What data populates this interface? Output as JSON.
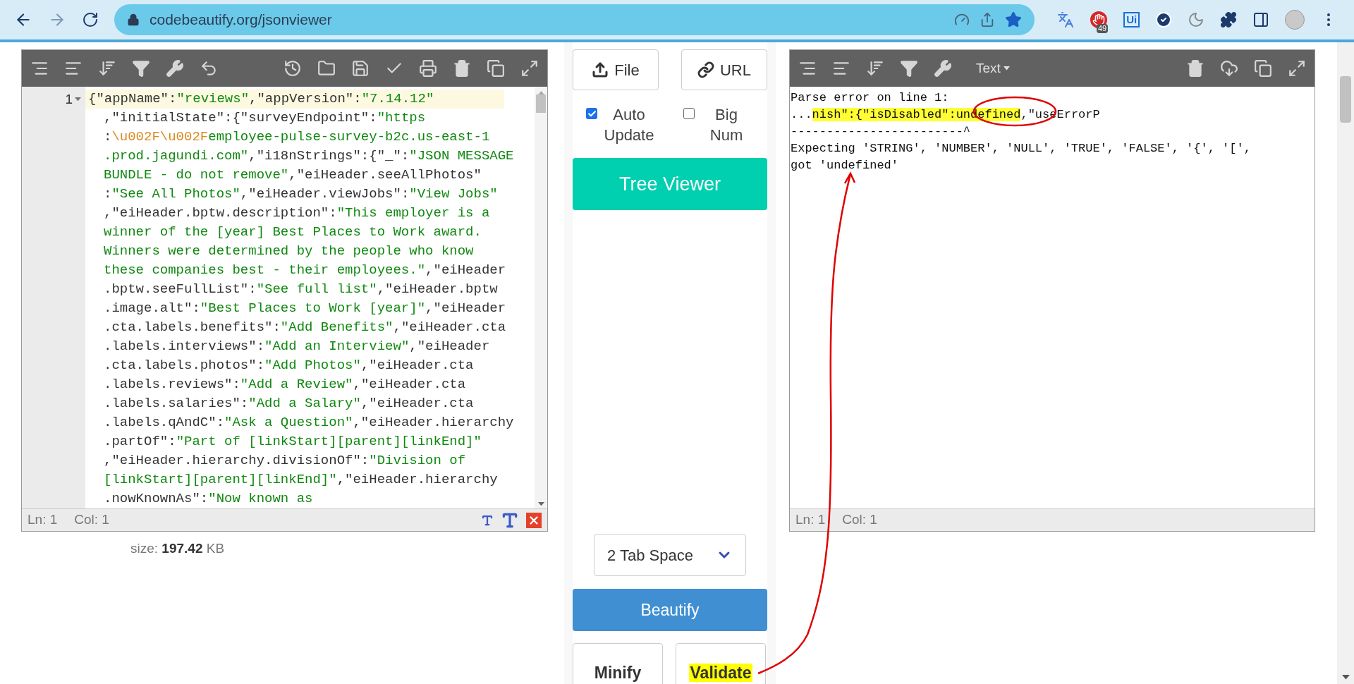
{
  "browser": {
    "url": "codebeautify.org/jsonviewer",
    "back_disabled": false,
    "forward_disabled": true,
    "bookmarked": true,
    "extensions": [
      {
        "kind": "translate"
      },
      {
        "kind": "blocker",
        "badge": "49"
      },
      {
        "kind": "ui",
        "label": "Ui"
      },
      {
        "kind": "check"
      },
      {
        "kind": "moon"
      },
      {
        "kind": "puzzle"
      },
      {
        "kind": "sidebar"
      },
      {
        "kind": "avatar"
      },
      {
        "kind": "menu"
      }
    ]
  },
  "input_editor": {
    "toolbar": [
      {
        "kind": "format"
      },
      {
        "kind": "compact"
      },
      {
        "kind": "sort"
      },
      {
        "kind": "filter"
      },
      {
        "kind": "repair"
      },
      {
        "kind": "undo"
      },
      {
        "kind": "spacer"
      },
      {
        "kind": "history"
      },
      {
        "kind": "open"
      },
      {
        "kind": "save"
      },
      {
        "kind": "check"
      },
      {
        "kind": "print"
      },
      {
        "kind": "delete"
      },
      {
        "kind": "copy"
      },
      {
        "kind": "fullscreen"
      }
    ],
    "line_number": "1",
    "lines": [
      [
        {
          "kind": "plain",
          "text": "{\"appName\":"
        },
        {
          "kind": "string",
          "text": "\"reviews\""
        },
        {
          "kind": "plain",
          "text": ",\"appVersion\":"
        },
        {
          "kind": "string",
          "text": "\"7.14.12\""
        }
      ],
      [
        {
          "kind": "plain",
          "text": ",\"initialState\":{\"surveyEndpoint\":"
        },
        {
          "kind": "string",
          "text": "\"https"
        }
      ],
      [
        {
          "kind": "plain",
          "text": ":"
        },
        {
          "kind": "escape",
          "text": "\\u002F\\u002F"
        },
        {
          "kind": "string",
          "text": "employee-pulse-survey-b2c.us-east-1"
        }
      ],
      [
        {
          "kind": "string",
          "text": ".prod.jagundi.com\""
        },
        {
          "kind": "plain",
          "text": ",\"i18nStrings\":{\"_\":"
        },
        {
          "kind": "string",
          "text": "\"JSON MESSAGE"
        }
      ],
      [
        {
          "kind": "string",
          "text": "BUNDLE - do not remove\""
        },
        {
          "kind": "plain",
          "text": ",\"eiHeader.seeAllPhotos\""
        }
      ],
      [
        {
          "kind": "plain",
          "text": ":"
        },
        {
          "kind": "string",
          "text": "\"See All Photos\""
        },
        {
          "kind": "plain",
          "text": ",\"eiHeader.viewJobs\":"
        },
        {
          "kind": "string",
          "text": "\"View Jobs\""
        }
      ],
      [
        {
          "kind": "plain",
          "text": ",\"eiHeader.bptw.description\":"
        },
        {
          "kind": "string",
          "text": "\"This employer is a"
        }
      ],
      [
        {
          "kind": "string",
          "text": "winner of the [year] Best Places to Work award."
        }
      ],
      [
        {
          "kind": "string",
          "text": "Winners were determined by the people who know"
        }
      ],
      [
        {
          "kind": "string",
          "text": "these companies best - their employees.\""
        },
        {
          "kind": "plain",
          "text": ",\"eiHeader"
        }
      ],
      [
        {
          "kind": "plain",
          "text": ".bptw.seeFullList\":"
        },
        {
          "kind": "string",
          "text": "\"See full list\""
        },
        {
          "kind": "plain",
          "text": ",\"eiHeader.bptw"
        }
      ],
      [
        {
          "kind": "plain",
          "text": ".image.alt\":"
        },
        {
          "kind": "string",
          "text": "\"Best Places to Work [year]\""
        },
        {
          "kind": "plain",
          "text": ",\"eiHeader"
        }
      ],
      [
        {
          "kind": "plain",
          "text": ".cta.labels.benefits\":"
        },
        {
          "kind": "string",
          "text": "\"Add Benefits\""
        },
        {
          "kind": "plain",
          "text": ",\"eiHeader.cta"
        }
      ],
      [
        {
          "kind": "plain",
          "text": ".labels.interviews\":"
        },
        {
          "kind": "string",
          "text": "\"Add an Interview\""
        },
        {
          "kind": "plain",
          "text": ",\"eiHeader"
        }
      ],
      [
        {
          "kind": "plain",
          "text": ".cta.labels.photos\":"
        },
        {
          "kind": "string",
          "text": "\"Add Photos\""
        },
        {
          "kind": "plain",
          "text": ",\"eiHeader.cta"
        }
      ],
      [
        {
          "kind": "plain",
          "text": ".labels.reviews\":"
        },
        {
          "kind": "string",
          "text": "\"Add a Review\""
        },
        {
          "kind": "plain",
          "text": ",\"eiHeader.cta"
        }
      ],
      [
        {
          "kind": "plain",
          "text": ".labels.salaries\":"
        },
        {
          "kind": "string",
          "text": "\"Add a Salary\""
        },
        {
          "kind": "plain",
          "text": ",\"eiHeader.cta"
        }
      ],
      [
        {
          "kind": "plain",
          "text": ".labels.qAndC\":"
        },
        {
          "kind": "string",
          "text": "\"Ask a Question\""
        },
        {
          "kind": "plain",
          "text": ",\"eiHeader.hierarchy"
        }
      ],
      [
        {
          "kind": "plain",
          "text": ".partOf\":"
        },
        {
          "kind": "string",
          "text": "\"Part of [linkStart][parent][linkEnd]\""
        }
      ],
      [
        {
          "kind": "plain",
          "text": ",\"eiHeader.hierarchy.divisionOf\":"
        },
        {
          "kind": "string",
          "text": "\"Division of"
        }
      ],
      [
        {
          "kind": "string",
          "text": "[linkStart][parent][linkEnd]\""
        },
        {
          "kind": "plain",
          "text": ",\"eiHeader.hierarchy"
        }
      ],
      [
        {
          "kind": "plain",
          "text": ".nowKnownAs\":"
        },
        {
          "kind": "string",
          "text": "\"Now known as"
        }
      ]
    ],
    "status": {
      "line": "Ln: 1",
      "column": "Col: 1"
    },
    "size": {
      "label": "size:",
      "value": "197.42",
      "unit": "KB"
    }
  },
  "controls": {
    "file_button": "File",
    "url_button": "URL",
    "options": [
      {
        "label": "Auto Update",
        "checked": true
      },
      {
        "label": "Big Num",
        "checked": false
      }
    ],
    "tree_viewer_button": "Tree Viewer",
    "indent_select": "2 Tab Space",
    "beautify_button": "Beautify",
    "bottom_buttons": [
      {
        "label": "Minify",
        "highlighted": false
      },
      {
        "label": "Validate",
        "highlighted": true
      }
    ]
  },
  "output_panel": {
    "toolbar": [
      {
        "kind": "format"
      },
      {
        "kind": "compact"
      },
      {
        "kind": "sort"
      },
      {
        "kind": "filter"
      },
      {
        "kind": "repair"
      },
      {
        "kind": "mode",
        "label": "Text"
      },
      {
        "kind": "spacer"
      },
      {
        "kind": "delete"
      },
      {
        "kind": "download"
      },
      {
        "kind": "copy"
      },
      {
        "kind": "fullscreen"
      }
    ],
    "lines": [
      [
        {
          "text": "Parse error on line 1:",
          "highlighted": false
        }
      ],
      [
        {
          "text": "...",
          "highlighted": false
        },
        {
          "text": "nish\":{\"isDisabled\":undefined",
          "highlighted": true
        },
        {
          "text": ",\"useErrorP",
          "highlighted": false
        }
      ],
      [
        {
          "text": "------------------------^",
          "highlighted": false
        }
      ],
      [
        {
          "text": "Expecting 'STRING', 'NUMBER', 'NULL', 'TRUE', 'FALSE', '{', '[',",
          "highlighted": false
        }
      ],
      [
        {
          "text": "got 'undefined'",
          "highlighted": false
        }
      ]
    ],
    "status": {
      "line": "Ln: 1",
      "column": "Col: 1"
    }
  }
}
